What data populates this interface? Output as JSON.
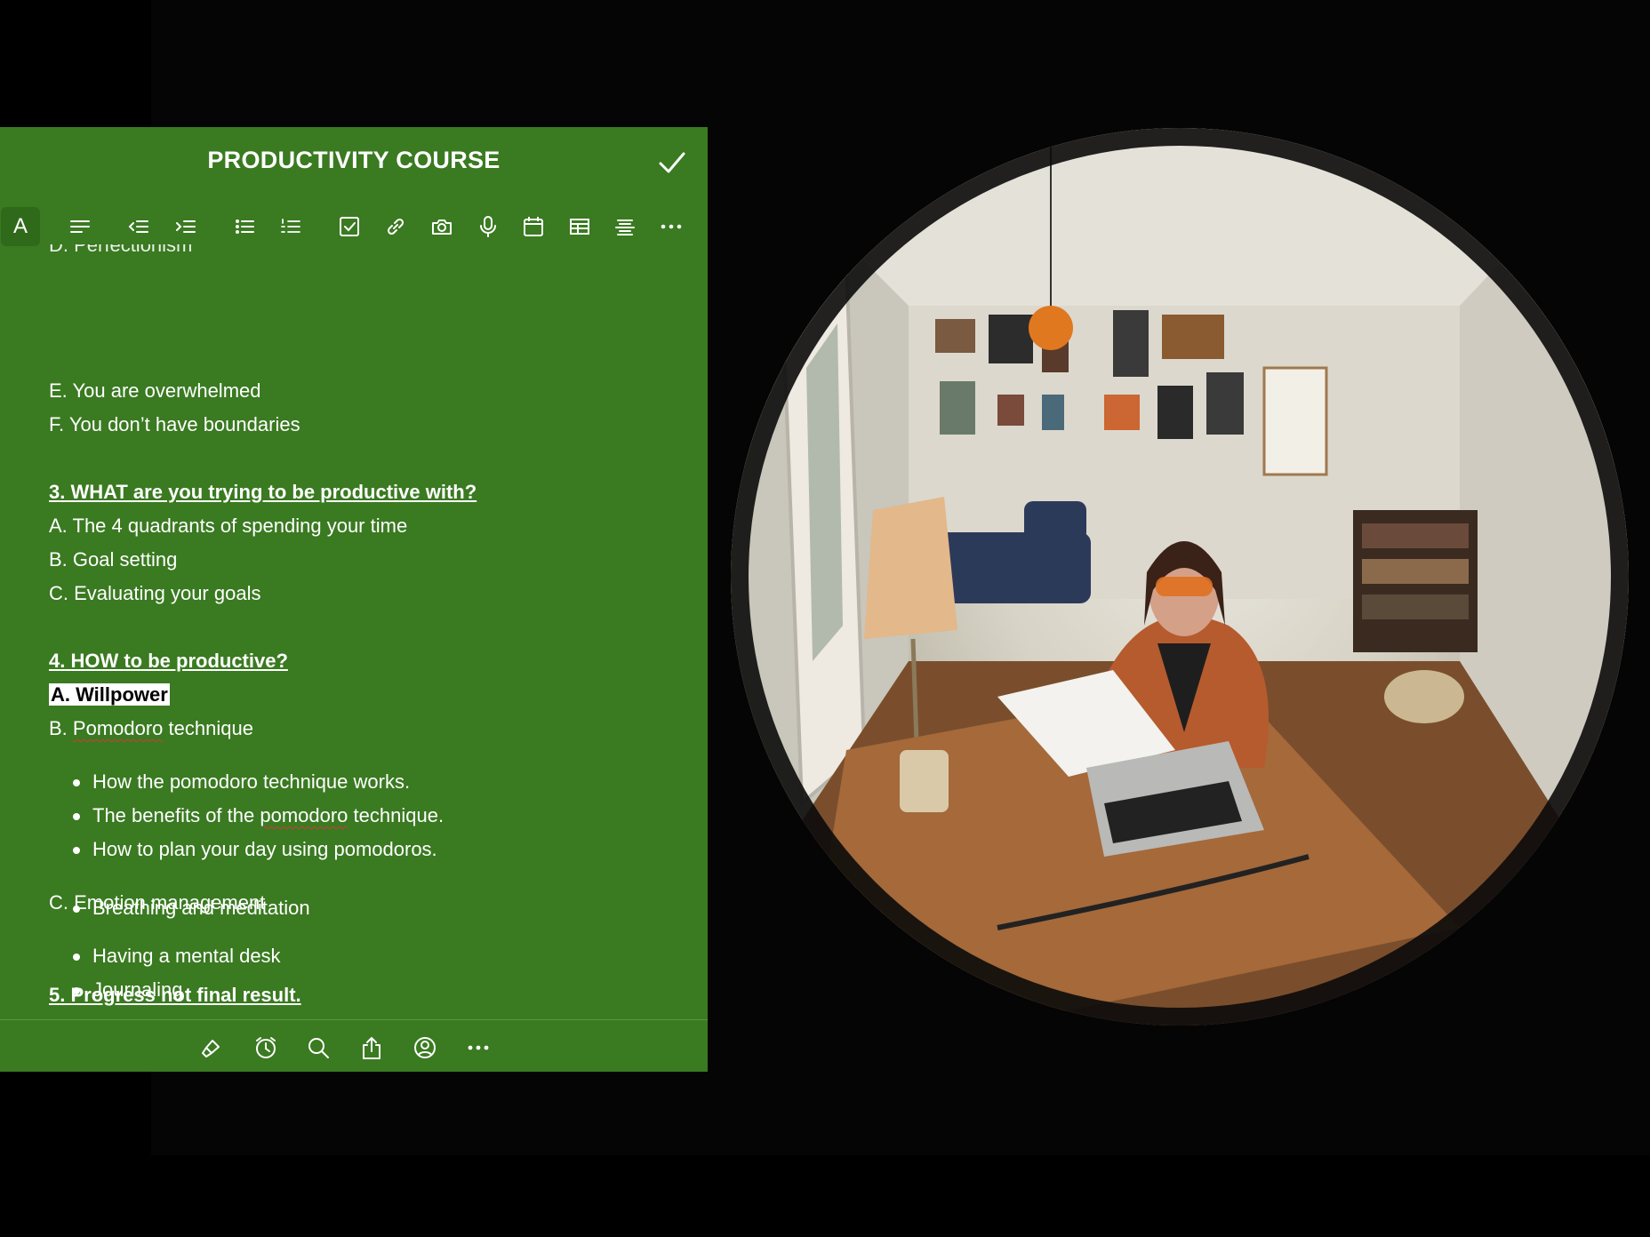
{
  "note": {
    "title": "PRODUCTIVITY COURSE",
    "format_letter": "A",
    "cut_line": "D. Perfectionism",
    "lines": {
      "e": "E. You are overwhelmed",
      "f": "F. You don’t have boundaries",
      "h3": "3. WHAT are you trying to be productive with?",
      "a3": "A. The 4 quadrants of spending your time",
      "b3": "B. Goal setting",
      "c3": "C. Evaluating your goals",
      "h4": "4. HOW to be productive?",
      "a4": "A. Willpower",
      "b4_prefix": "B. ",
      "b4_word": "Pomodoro",
      "b4_suffix": " technique",
      "bul1": "How the pomodoro technique works.",
      "bul2_prefix": "The benefits of the ",
      "bul2_word": "pomodoro",
      "bul2_suffix": " technique.",
      "bul3": "How to plan your day using pomodoros.",
      "c4": "C. Emotion management",
      "bul4": "Having a mental desk",
      "bul5": "Journaling",
      "bul6": "Breathing and meditation",
      "h5": "5. Progress not final result."
    }
  },
  "toolbar_icons": [
    "text-format-icon",
    "align-icon",
    "outdent-icon",
    "indent-icon",
    "bullet-list-icon",
    "numbered-list-icon",
    "checkbox-icon",
    "link-icon",
    "camera-icon",
    "microphone-icon",
    "calendar-icon",
    "table-icon",
    "strikethrough-icon",
    "more-icon"
  ],
  "bottom_icons": [
    "paint-brush-icon",
    "reminder-icon",
    "search-icon",
    "share-icon",
    "collaborate-icon",
    "more-icon"
  ],
  "colors": {
    "panel": "#3a7a21",
    "text": "#ffffff",
    "background": "#000000"
  }
}
